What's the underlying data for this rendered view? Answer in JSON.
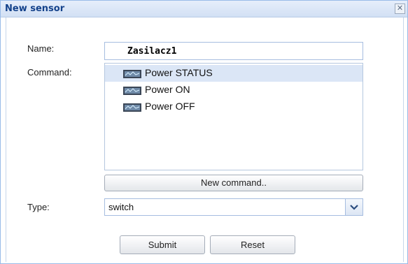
{
  "window": {
    "title": "New sensor",
    "close_glyph": "✕"
  },
  "form": {
    "name_label": "Name:",
    "name_value": "Zasilacz1",
    "command_label": "Command:",
    "commands": [
      {
        "label": "Power STATUS",
        "icon": "device-icon",
        "selected": true
      },
      {
        "label": "Power ON",
        "icon": "device-icon",
        "selected": false
      },
      {
        "label": "Power OFF",
        "icon": "device-icon",
        "selected": false
      }
    ],
    "new_command_label": "New command..",
    "type_label": "Type:",
    "type_value": "switch"
  },
  "actions": {
    "submit_label": "Submit",
    "reset_label": "Reset"
  },
  "colors": {
    "accent": "#14428b",
    "selection": "#dbe6f6",
    "border": "#a6bde0"
  }
}
